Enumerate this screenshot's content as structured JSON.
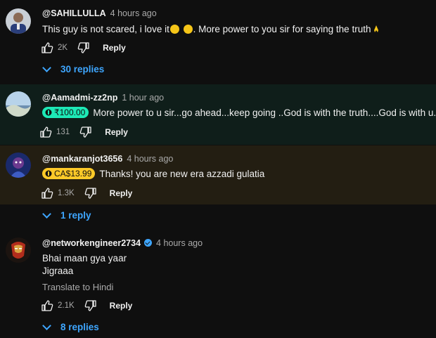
{
  "comments": [
    {
      "handle": "@SAHILLULLA",
      "time": "4 hours ago",
      "text_before": "This guy is not scared, i love it",
      "text_after": ". More power to you sir for saying the truth",
      "likes": "2K",
      "reply_label": "Reply",
      "replies_label": "30 replies"
    },
    {
      "handle": "@Aamadmi-zz2np",
      "time": "1 hour ago",
      "chip": "₹100.00",
      "chip_color": "#1de9b6",
      "text": "More power to u sir...go ahead...keep going ..God is with the truth....God is with u...sir",
      "likes": "131",
      "reply_label": "Reply"
    },
    {
      "handle": "@mankaranjot3656",
      "time": "4 hours ago",
      "chip": "CA$13.99",
      "chip_color": "#ffca28",
      "text": "Thanks! you are new era azzadi gulatia",
      "likes": "1.3K",
      "reply_label": "Reply",
      "replies_label": "1 reply"
    },
    {
      "handle": "@networkengineer2734",
      "time": "4 hours ago",
      "line1": "Bhai maan gya yaar",
      "line2": "Jigraaa",
      "translate": "Translate to Hindi",
      "likes": "2.1K",
      "reply_label": "Reply",
      "replies_label": "8 replies"
    }
  ],
  "colors": {
    "background": "#0f0f0f",
    "highlight_green": "#0f1e1a",
    "highlight_yellow": "#231e12",
    "link_blue": "#3ea6ff"
  },
  "icons": [
    "thumbs-up-icon",
    "thumbs-down-icon",
    "chevron-down-icon",
    "verified-icon",
    "pray-emoji",
    "laughing-emoji"
  ]
}
